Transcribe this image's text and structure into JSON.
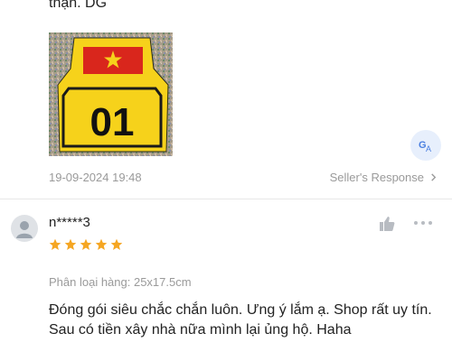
{
  "previous_review": {
    "text_tail": "thận. DG",
    "date": "19-09-2024 19:48",
    "seller_response_label": "Seller's Response",
    "image_text": "01"
  },
  "review": {
    "username": "n*****3",
    "rating": 5,
    "variation": "Phân loại hàng: 25x17.5cm",
    "comment": "Đóng gói siêu chắc chắn luôn. Ưng ý lắm ạ. Shop rất uy tín. Sau có tiền xây nhà nữa mình lại ủng hộ. Haha"
  },
  "colors": {
    "star": "#f5a623",
    "flag_red": "#d9261c",
    "plate_yellow": "#f6d21b",
    "translate_bg": "#e7effc",
    "translate_fg": "#4a7fe0"
  },
  "icons": {
    "translate": "translate-icon",
    "like": "thumbs-up-icon",
    "more": "more-dots-icon",
    "chevron": "chevron-right-icon",
    "avatar": "user-avatar-icon",
    "star": "star-icon"
  }
}
